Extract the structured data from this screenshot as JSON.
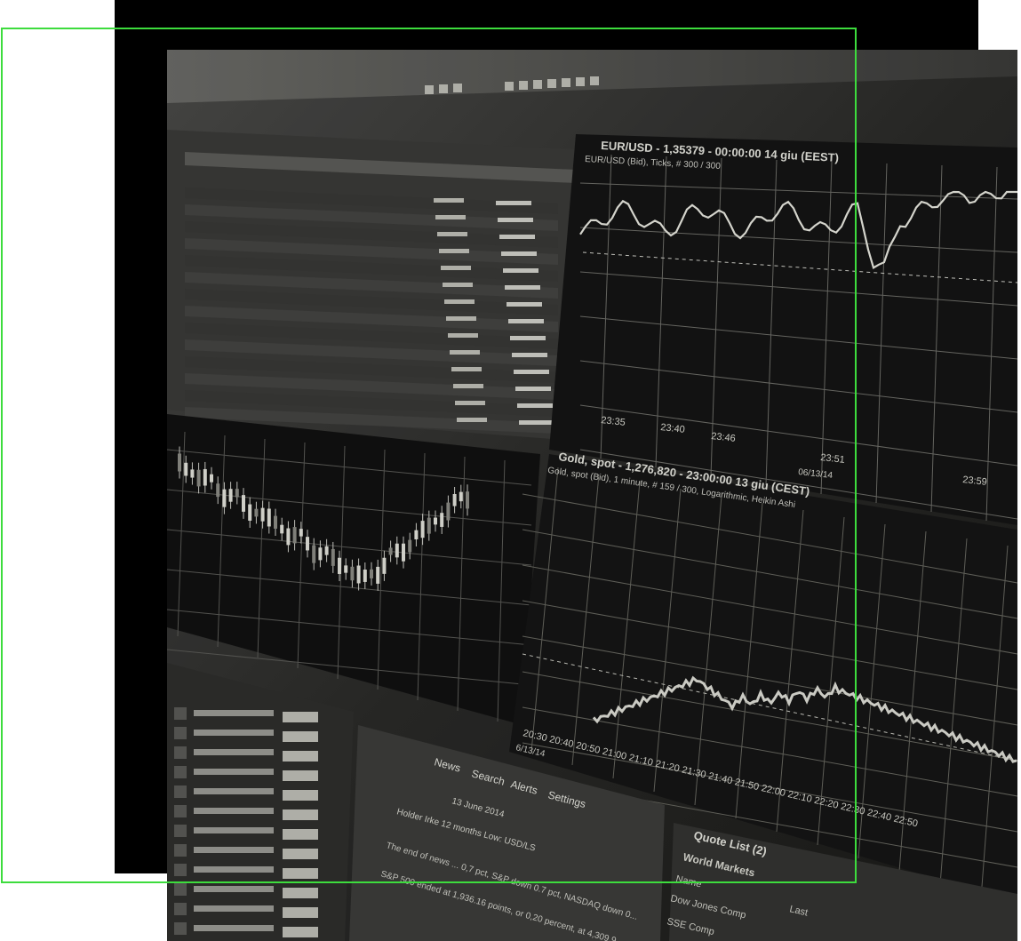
{
  "colors": {
    "page_background": "#ffffff",
    "backdrop": "#000000",
    "frame_accent": "#3ddc3d",
    "screen_dark": "#1a1a1a",
    "screen_text": "#d8d8d0"
  },
  "photo": {
    "subject": "financial-trading-monitor",
    "tone": "grayscale"
  },
  "eurusd_chart": {
    "title": "EUR/USD - 1,35379 - 00:00:00  14 giu (EEST)",
    "subtitle": "EUR/USD (Bid), Ticks, # 300 / 300",
    "time_labels": [
      "23:35",
      "23:40",
      "23:46",
      "23:51",
      "23:59"
    ],
    "date_label": "06/13/14"
  },
  "gold_chart": {
    "title": "Gold, spot - 1,276,820 - 23:00:00  13 giu (CEST)",
    "subtitle": "Gold, spot (Bid), 1 minute, # 159 / 300, Logarithmic, Heikin Ashi",
    "time_labels": "20:30 20:40 20:50 21:00 21:10 21:20 21:30 21:40 21:50 22:00 22:10 22:20 22:30 22:40 22:50",
    "date_label": "6/13/14"
  },
  "news_panel": {
    "tabs": [
      "News",
      "Search",
      "Alerts",
      "Settings"
    ],
    "date": "13 June 2014",
    "headline": "Holder Irke 12 months Low: USD/LS",
    "lines": [
      "The end of news ... 0,7 pct, S&P down 0.7 pct, NASDAQ down 0...",
      "S&P 500 ended at 1,936.16 points, or 0,20 percent, at 4,309.9..."
    ]
  },
  "quote_list": {
    "title": "Quote List (2)",
    "tab": "World Markets",
    "col_name": "Name",
    "col_last": "Last",
    "rows": [
      "Dow Jones Comp",
      "SSE Comp"
    ]
  }
}
